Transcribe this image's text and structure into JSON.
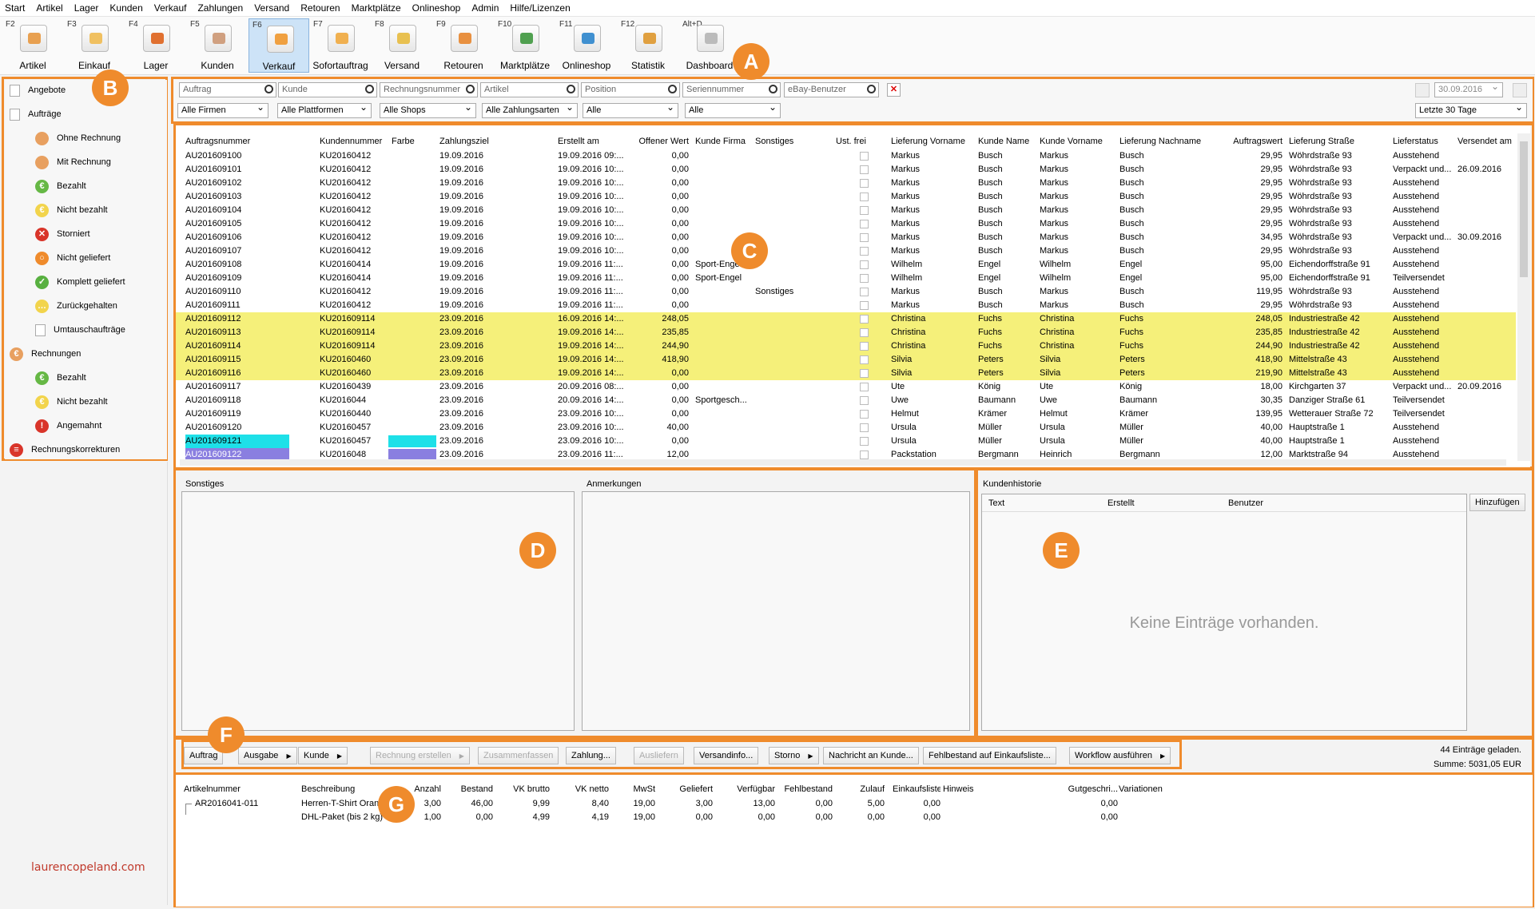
{
  "menu": [
    "Start",
    "Artikel",
    "Lager",
    "Kunden",
    "Verkauf",
    "Zahlungen",
    "Versand",
    "Retouren",
    "Marktplätze",
    "Onlineshop",
    "Admin",
    "Hilfe/Lizenzen"
  ],
  "toolbar": [
    {
      "key": "F2",
      "label": "Artikel",
      "icon": "tag-icon",
      "color": "#e8a050"
    },
    {
      "key": "F3",
      "label": "Einkauf",
      "icon": "box-in-icon",
      "color": "#f0c060"
    },
    {
      "key": "F4",
      "label": "Lager",
      "icon": "warehouse-icon",
      "color": "#e07030"
    },
    {
      "key": "F5",
      "label": "Kunden",
      "icon": "customer-icon",
      "color": "#d0a080"
    },
    {
      "key": "F6",
      "label": "Verkauf",
      "icon": "sales-icon",
      "color": "#f0a040"
    },
    {
      "key": "F7",
      "label": "Sofortauftrag",
      "icon": "instant-order-icon",
      "color": "#f0b050"
    },
    {
      "key": "F8",
      "label": "Versand",
      "icon": "shipping-icon",
      "color": "#e8c050"
    },
    {
      "key": "F9",
      "label": "Retouren",
      "icon": "returns-icon",
      "color": "#e89040"
    },
    {
      "key": "F10",
      "label": "Marktplätze",
      "icon": "marketplace-icon",
      "color": "#50a050"
    },
    {
      "key": "F11",
      "label": "Onlineshop",
      "icon": "onlineshop-icon",
      "color": "#4090d0"
    },
    {
      "key": "F12",
      "label": "Statistik",
      "icon": "statistics-icon",
      "color": "#e0a040"
    },
    {
      "key": "Alt+D",
      "label": "Dashboard",
      "icon": "dashboard-icon",
      "color": "#bbbbbb"
    }
  ],
  "badges": [
    "A",
    "B",
    "C",
    "D",
    "E",
    "F",
    "G"
  ],
  "sidebar": [
    {
      "label": "Angebote",
      "icon": "document-icon",
      "kind": "file",
      "color": ""
    },
    {
      "label": "Aufträge",
      "icon": "document-icon",
      "kind": "file",
      "color": ""
    },
    {
      "label": "Ohne Rechnung",
      "icon": "no-invoice-icon",
      "kind": "circle",
      "color": "#e8a060",
      "sym": ""
    },
    {
      "label": "Mit Rechnung",
      "icon": "invoice-icon",
      "kind": "circle",
      "color": "#e8a060",
      "sym": ""
    },
    {
      "label": "Bezahlt",
      "icon": "paid-icon",
      "kind": "circle",
      "color": "#66b845",
      "sym": "€"
    },
    {
      "label": "Nicht bezahlt",
      "icon": "unpaid-icon",
      "kind": "circle",
      "color": "#f2d44c",
      "sym": "€"
    },
    {
      "label": "Storniert",
      "icon": "cancelled-icon",
      "kind": "circle",
      "color": "#d9352a",
      "sym": "✕"
    },
    {
      "label": "Nicht geliefert",
      "icon": "not-delivered-icon",
      "kind": "circle",
      "color": "#ef8b2c",
      "sym": "○"
    },
    {
      "label": "Komplett geliefert",
      "icon": "delivered-check-icon",
      "kind": "circle",
      "color": "#58b040",
      "sym": "✓"
    },
    {
      "label": "Zurückgehalten",
      "icon": "held-icon",
      "kind": "circle",
      "color": "#f2d44c",
      "sym": "…"
    },
    {
      "label": "Umtauschaufträge",
      "icon": "exchange-icon",
      "kind": "file",
      "color": ""
    },
    {
      "label": "Rechnungen",
      "icon": "invoice-folder-icon",
      "kind": "circle",
      "color": "#e8a060",
      "sym": "€"
    },
    {
      "label": "Bezahlt",
      "icon": "paid-icon",
      "kind": "circle",
      "color": "#66b845",
      "sym": "€"
    },
    {
      "label": "Nicht bezahlt",
      "icon": "unpaid-icon",
      "kind": "circle",
      "color": "#f2d44c",
      "sym": "€"
    },
    {
      "label": "Angemahnt",
      "icon": "reminded-icon",
      "kind": "circle",
      "color": "#d9352a",
      "sym": "!"
    },
    {
      "label": "Rechnungskorrekturen",
      "icon": "correction-icon",
      "kind": "circle",
      "color": "#d9352a",
      "sym": "≡"
    }
  ],
  "filters": {
    "search": [
      "Auftrag",
      "Kunde",
      "Rechnungsnummer",
      "Artikel",
      "Position",
      "Seriennummer",
      "eBay-Benutzer"
    ],
    "date": "30.09.2016",
    "selects": [
      "Alle Firmen",
      "Alle Plattformen",
      "Alle Shops",
      "Alle Zahlungsarten",
      "Alle",
      "Alle"
    ],
    "period": "Letzte 30 Tage"
  },
  "grid": {
    "columns": [
      "Auftragsnummer",
      "Kundennummer",
      "Farbe",
      "Zahlungsziel",
      "Erstellt am",
      "Offener Wert",
      "Kunde Firma",
      "Sonstiges",
      "Ust. frei",
      "Lieferung Vorname",
      "Kunde Name",
      "Kunde Vorname",
      "Lieferung Nachname",
      "Auftragswert",
      "Lieferung Straße",
      "Lieferstatus",
      "Versendet am"
    ],
    "rows": [
      [
        "AU201609100",
        "KU20160412",
        "",
        "19.09.2016",
        "19.09.2016 09:...",
        "0,00",
        "",
        "",
        "",
        "Markus",
        "Busch",
        "Markus",
        "Busch",
        "29,95",
        "Wöhrdstraße 93",
        "Ausstehend",
        ""
      ],
      [
        "AU201609101",
        "KU20160412",
        "",
        "19.09.2016",
        "19.09.2016 10:...",
        "0,00",
        "",
        "",
        "",
        "Markus",
        "Busch",
        "Markus",
        "Busch",
        "29,95",
        "Wöhrdstraße 93",
        "Verpackt und...",
        "26.09.2016"
      ],
      [
        "AU201609102",
        "KU20160412",
        "",
        "19.09.2016",
        "19.09.2016 10:...",
        "0,00",
        "",
        "",
        "",
        "Markus",
        "Busch",
        "Markus",
        "Busch",
        "29,95",
        "Wöhrdstraße 93",
        "Ausstehend",
        ""
      ],
      [
        "AU201609103",
        "KU20160412",
        "",
        "19.09.2016",
        "19.09.2016 10:...",
        "0,00",
        "",
        "",
        "",
        "Markus",
        "Busch",
        "Markus",
        "Busch",
        "29,95",
        "Wöhrdstraße 93",
        "Ausstehend",
        ""
      ],
      [
        "AU201609104",
        "KU20160412",
        "",
        "19.09.2016",
        "19.09.2016 10:...",
        "0,00",
        "",
        "",
        "",
        "Markus",
        "Busch",
        "Markus",
        "Busch",
        "29,95",
        "Wöhrdstraße 93",
        "Ausstehend",
        ""
      ],
      [
        "AU201609105",
        "KU20160412",
        "",
        "19.09.2016",
        "19.09.2016 10:...",
        "0,00",
        "",
        "",
        "",
        "Markus",
        "Busch",
        "Markus",
        "Busch",
        "29,95",
        "Wöhrdstraße 93",
        "Ausstehend",
        ""
      ],
      [
        "AU201609106",
        "KU20160412",
        "",
        "19.09.2016",
        "19.09.2016 10:...",
        "0,00",
        "",
        "",
        "",
        "Markus",
        "Busch",
        "Markus",
        "Busch",
        "34,95",
        "Wöhrdstraße 93",
        "Verpackt und...",
        "30.09.2016"
      ],
      [
        "AU201609107",
        "KU20160412",
        "",
        "19.09.2016",
        "19.09.2016 10:...",
        "0,00",
        "",
        "",
        "",
        "Markus",
        "Busch",
        "Markus",
        "Busch",
        "29,95",
        "Wöhrdstraße 93",
        "Ausstehend",
        ""
      ],
      [
        "AU201609108",
        "KU20160414",
        "",
        "19.09.2016",
        "19.09.2016 11:...",
        "0,00",
        "Sport-Engel",
        "",
        "",
        "Wilhelm",
        "Engel",
        "Wilhelm",
        "Engel",
        "95,00",
        "Eichendorffstraße 91",
        "Ausstehend",
        ""
      ],
      [
        "AU201609109",
        "KU20160414",
        "",
        "19.09.2016",
        "19.09.2016 11:...",
        "0,00",
        "Sport-Engel",
        "",
        "",
        "Wilhelm",
        "Engel",
        "Wilhelm",
        "Engel",
        "95,00",
        "Eichendorffstraße 91",
        "Teilversendet",
        ""
      ],
      [
        "AU201609110",
        "KU20160412",
        "",
        "19.09.2016",
        "19.09.2016 11:...",
        "0,00",
        "",
        "Sonstiges",
        "",
        "Markus",
        "Busch",
        "Markus",
        "Busch",
        "119,95",
        "Wöhrdstraße 93",
        "Ausstehend",
        ""
      ],
      [
        "AU201609111",
        "KU20160412",
        "",
        "19.09.2016",
        "19.09.2016 11:...",
        "0,00",
        "",
        "",
        "",
        "Markus",
        "Busch",
        "Markus",
        "Busch",
        "29,95",
        "Wöhrdstraße 93",
        "Ausstehend",
        ""
      ],
      [
        "AU201609112",
        "KU201609114",
        "",
        "23.09.2016",
        "16.09.2016 14:...",
        "248,05",
        "",
        "",
        "",
        "Christina",
        "Fuchs",
        "Christina",
        "Fuchs",
        "248,05",
        "Industriestraße 42",
        "Ausstehend",
        ""
      ],
      [
        "AU201609113",
        "KU201609114",
        "",
        "23.09.2016",
        "19.09.2016 14:...",
        "235,85",
        "",
        "",
        "",
        "Christina",
        "Fuchs",
        "Christina",
        "Fuchs",
        "235,85",
        "Industriestraße 42",
        "Ausstehend",
        ""
      ],
      [
        "AU201609114",
        "KU201609114",
        "",
        "23.09.2016",
        "19.09.2016 14:...",
        "244,90",
        "",
        "",
        "",
        "Christina",
        "Fuchs",
        "Christina",
        "Fuchs",
        "244,90",
        "Industriestraße 42",
        "Ausstehend",
        ""
      ],
      [
        "AU201609115",
        "KU20160460",
        "",
        "23.09.2016",
        "19.09.2016 14:...",
        "418,90",
        "",
        "",
        "",
        "Silvia",
        "Peters",
        "Silvia",
        "Peters",
        "418,90",
        "Mittelstraße 43",
        "Ausstehend",
        ""
      ],
      [
        "AU201609116",
        "KU20160460",
        "",
        "23.09.2016",
        "19.09.2016 14:...",
        "0,00",
        "",
        "",
        "",
        "Silvia",
        "Peters",
        "Silvia",
        "Peters",
        "219,90",
        "Mittelstraße 43",
        "Ausstehend",
        ""
      ],
      [
        "AU201609117",
        "KU20160439",
        "",
        "23.09.2016",
        "20.09.2016 08:...",
        "0,00",
        "",
        "",
        "",
        "Ute",
        "König",
        "Ute",
        "König",
        "18,00",
        "Kirchgarten 37",
        "Verpackt und...",
        "20.09.2016"
      ],
      [
        "AU201609118",
        "KU2016044",
        "",
        "23.09.2016",
        "20.09.2016 14:...",
        "0,00",
        "Sportgesch...",
        "",
        "",
        "Uwe",
        "Baumann",
        "Uwe",
        "Baumann",
        "30,35",
        "Danziger Straße 61",
        "Teilversendet",
        ""
      ],
      [
        "AU201609119",
        "KU20160440",
        "",
        "23.09.2016",
        "23.09.2016 10:...",
        "0,00",
        "",
        "",
        "",
        "Helmut",
        "Krämer",
        "Helmut",
        "Krämer",
        "139,95",
        "Wetterauer Straße 72",
        "Teilversendet",
        ""
      ],
      [
        "AU201609120",
        "KU20160457",
        "",
        "23.09.2016",
        "23.09.2016 10:...",
        "40,00",
        "",
        "",
        "",
        "Ursula",
        "Müller",
        "Ursula",
        "Müller",
        "40,00",
        "Hauptstraße 1",
        "Ausstehend",
        ""
      ],
      [
        "AU201609121",
        "KU20160457",
        "",
        "23.09.2016",
        "23.09.2016 10:...",
        "0,00",
        "",
        "",
        "",
        "Ursula",
        "Müller",
        "Ursula",
        "Müller",
        "40,00",
        "Hauptstraße 1",
        "Ausstehend",
        ""
      ],
      [
        "AU201609122",
        "KU2016048",
        "",
        "23.09.2016",
        "23.09.2016 11:...",
        "12,00",
        "",
        "",
        "",
        "Packstation",
        "Bergmann",
        "Heinrich",
        "Bergmann",
        "12,00",
        "Marktstraße 94",
        "Ausstehend",
        ""
      ]
    ],
    "highlight_color": "#f5f07a",
    "cyan": "#1ee0e8",
    "purple": "#8a7fe0"
  },
  "panes": {
    "sonstiges": "Sonstiges",
    "anmerkungen": "Anmerkungen",
    "kundenhistorie": "Kundenhistorie",
    "hist_cols": [
      "Text",
      "Erstellt",
      "Benutzer"
    ],
    "empty": "Keine Einträge vorhanden.",
    "add": "Hinzufügen"
  },
  "actions": [
    {
      "label": "Auftrag",
      "arrow": false,
      "disabled": false
    },
    {
      "label": "Ausgabe",
      "arrow": true,
      "disabled": false
    },
    {
      "label": "Kunde",
      "arrow": true,
      "disabled": false
    },
    {
      "label": "Rechnung erstellen",
      "arrow": true,
      "disabled": true
    },
    {
      "label": "Zusammenfassen",
      "arrow": false,
      "disabled": true
    },
    {
      "label": "Zahlung...",
      "arrow": false,
      "disabled": false
    },
    {
      "label": "Ausliefern",
      "arrow": false,
      "disabled": true
    },
    {
      "label": "Versandinfo...",
      "arrow": false,
      "disabled": false
    },
    {
      "label": "Storno",
      "arrow": true,
      "disabled": false
    },
    {
      "label": "Nachricht an Kunde...",
      "arrow": false,
      "disabled": false
    },
    {
      "label": "Fehlbestand auf Einkaufsliste...",
      "arrow": false,
      "disabled": false
    },
    {
      "label": "Workflow ausführen",
      "arrow": true,
      "disabled": false
    }
  ],
  "status": {
    "loaded": "44 Einträge geladen.",
    "sum": "Summe: 5031,05 EUR"
  },
  "detail": {
    "columns": [
      "Artikelnummer",
      "Beschreibung",
      "Anzahl",
      "Bestand",
      "VK brutto",
      "VK netto",
      "MwSt",
      "Geliefert",
      "Verfügbar",
      "Fehlbestand",
      "Zulauf",
      "Einkaufsliste",
      "Hinweis",
      "Gutgeschri...",
      "Variationen"
    ],
    "rows": [
      [
        "AR2016041-011",
        "Herren-T-Shirt Orange XL",
        "3,00",
        "46,00",
        "9,99",
        "8,40",
        "19,00",
        "3,00",
        "13,00",
        "0,00",
        "5,00",
        "0,00",
        "",
        "0,00",
        ""
      ],
      [
        "",
        "DHL-Paket (bis 2 kg)",
        "1,00",
        "0,00",
        "4,99",
        "4,19",
        "19,00",
        "0,00",
        "0,00",
        "0,00",
        "0,00",
        "0,00",
        "",
        "0,00",
        ""
      ]
    ]
  },
  "watermark": "laurencopeland.com",
  "accent": "#ef8b2c"
}
